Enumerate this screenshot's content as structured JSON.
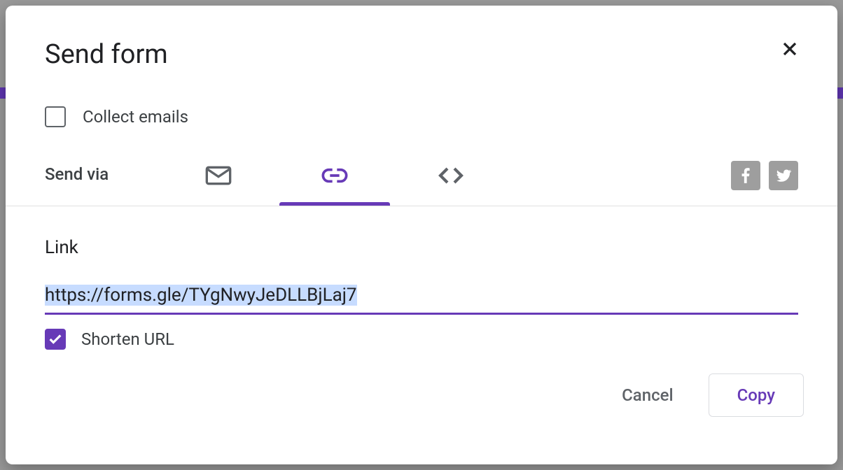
{
  "dialog": {
    "title": "Send form",
    "collect_emails_label": "Collect emails",
    "collect_emails_checked": false,
    "send_via_label": "Send via",
    "tabs": {
      "email": "email",
      "link": "link",
      "embed": "embed",
      "active": "link"
    },
    "section_heading": "Link",
    "url_value": "https://forms.gle/TYgNwyJeDLLBjLaj7",
    "shorten_label": "Shorten URL",
    "shorten_checked": true,
    "cancel_label": "Cancel",
    "copy_label": "Copy"
  },
  "colors": {
    "primary": "#673ab7",
    "text": "#202124",
    "secondary_text": "#5f6368"
  }
}
